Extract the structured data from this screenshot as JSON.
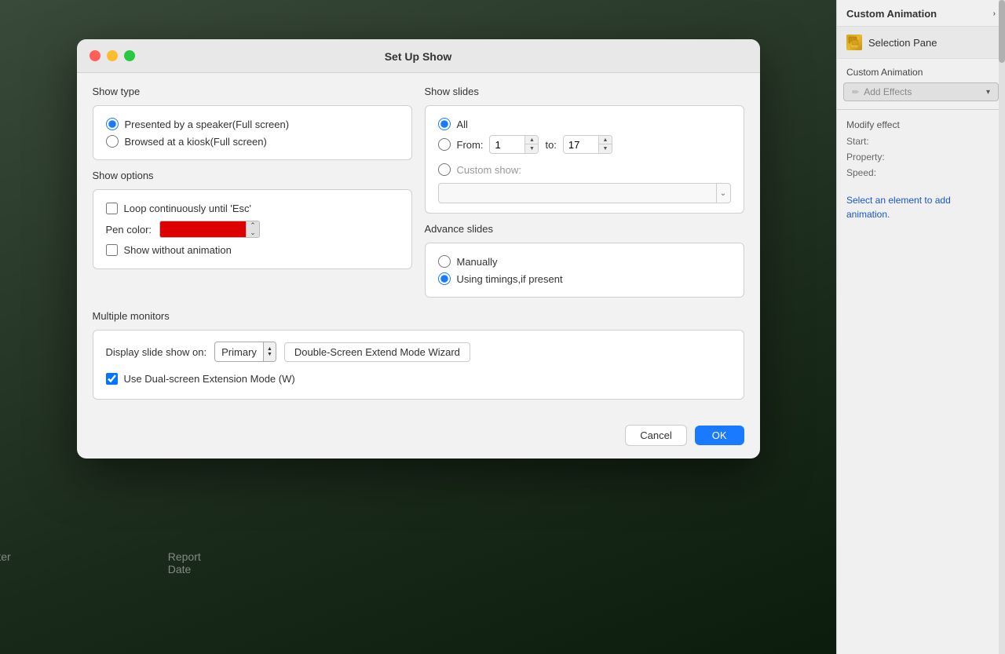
{
  "sidebar": {
    "custom_animation_label": "Custom Animation",
    "chevron": "›",
    "selection_pane_label": "Selection Pane",
    "custom_anim_sub": "Custom Animation",
    "add_effects_label": "Add Effects",
    "add_effects_arrow": "▾",
    "modify_effect_label": "Modify effect",
    "start_label": "Start:",
    "property_label": "Property:",
    "speed_label": "Speed:",
    "select_msg": "Select an element to add animation."
  },
  "dialog": {
    "title": "Set Up Show",
    "show_type_label": "Show type",
    "radio1_label": "Presented by a speaker(Full screen)",
    "radio2_label": "Browsed at a kiosk(Full screen)",
    "show_options_label": "Show options",
    "loop_label": "Loop continuously until 'Esc'",
    "pen_color_label": "Pen color:",
    "show_without_anim_label": "Show without animation",
    "multiple_monitors_label": "Multiple monitors",
    "display_label": "Display slide show on:",
    "display_value": "Primary",
    "wizard_btn_label": "Double-Screen Extend Mode Wizard",
    "dual_screen_label": "Use Dual-screen Extension Mode (W)",
    "show_slides_label": "Show slides",
    "all_label": "All",
    "from_label": "From:",
    "from_value": "1",
    "to_label": "to:",
    "to_value": "17",
    "custom_show_label": "Custom show:",
    "advance_slides_label": "Advance slides",
    "manually_label": "Manually",
    "using_timings_label": "Using timings,if present",
    "cancel_label": "Cancel",
    "ok_label": "OK"
  },
  "footer": {
    "reporter_name": "Reporter Name",
    "report_date": "Report Date"
  },
  "colors": {
    "accent_blue": "#1a7aff",
    "pen_red": "#dd0000",
    "ok_btn": "#1a7aff",
    "dialog_bg": "#f2f2f2",
    "panel_bg": "#ffffff",
    "sidebar_bg": "#f0f0f0"
  }
}
